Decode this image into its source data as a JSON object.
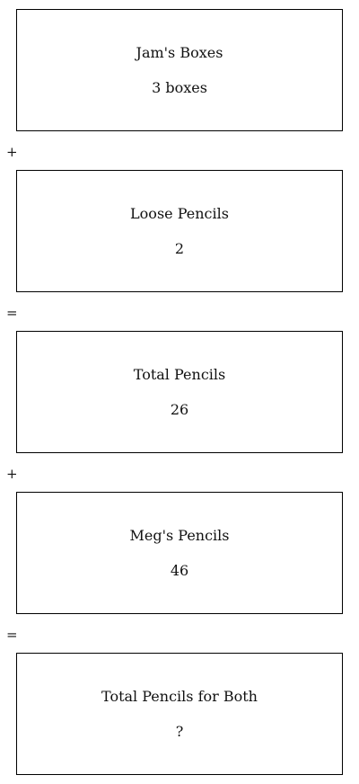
{
  "steps": [
    {
      "label": "Jam's Boxes",
      "value": "3 boxes"
    },
    {
      "label": "Loose Pencils",
      "value": "2"
    },
    {
      "label": "Total Pencils",
      "value": "26"
    },
    {
      "label": "Meg's Pencils",
      "value": "46"
    },
    {
      "label": "Total Pencils for Both",
      "value": "?"
    }
  ],
  "operators": [
    "+",
    "=",
    "+",
    "="
  ]
}
